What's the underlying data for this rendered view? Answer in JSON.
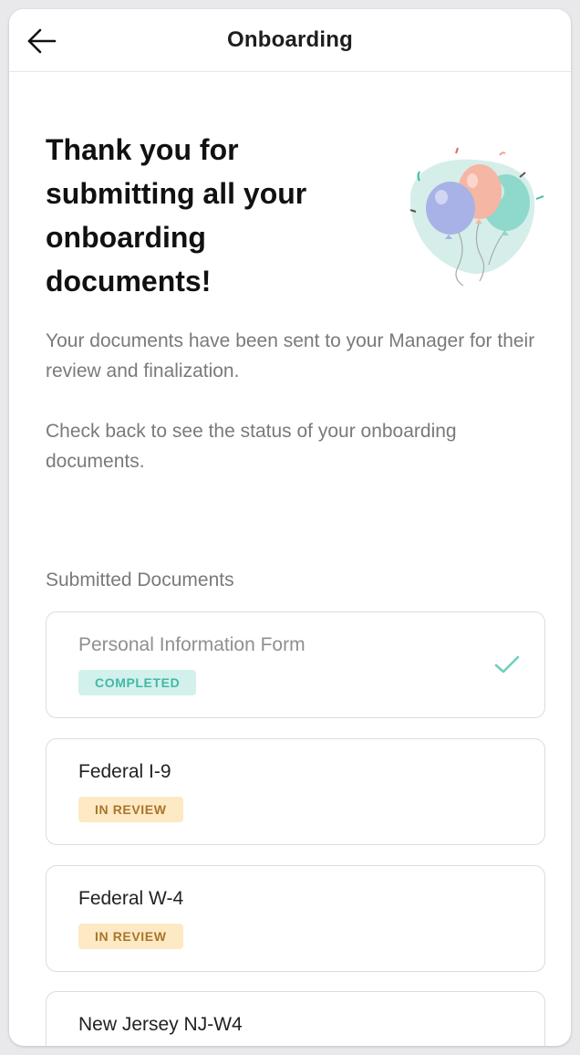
{
  "header": {
    "title": "Onboarding",
    "back_icon": "arrow-left-icon"
  },
  "hero": {
    "title": "Thank you for submitting all your onboarding documents!",
    "illustration": "balloons-illustration"
  },
  "body": {
    "paragraph_1": "Your documents have been sent to your Manager for their review and finalization.",
    "paragraph_2": "Check back to see the status of your onboarding documents."
  },
  "submitted": {
    "label": "Submitted Documents",
    "documents": [
      {
        "name": "Personal Information Form",
        "status": "COMPLETED",
        "icon": "checkmark-icon"
      },
      {
        "name": "Federal I-9",
        "status": "IN REVIEW"
      },
      {
        "name": "Federal W-4",
        "status": "IN REVIEW"
      },
      {
        "name": "New Jersey NJ-W4"
      }
    ]
  },
  "colors": {
    "completed_bg": "#d2f1ec",
    "completed_text": "#43b8a6",
    "review_bg": "#fde9c4",
    "review_text": "#a9752a"
  }
}
